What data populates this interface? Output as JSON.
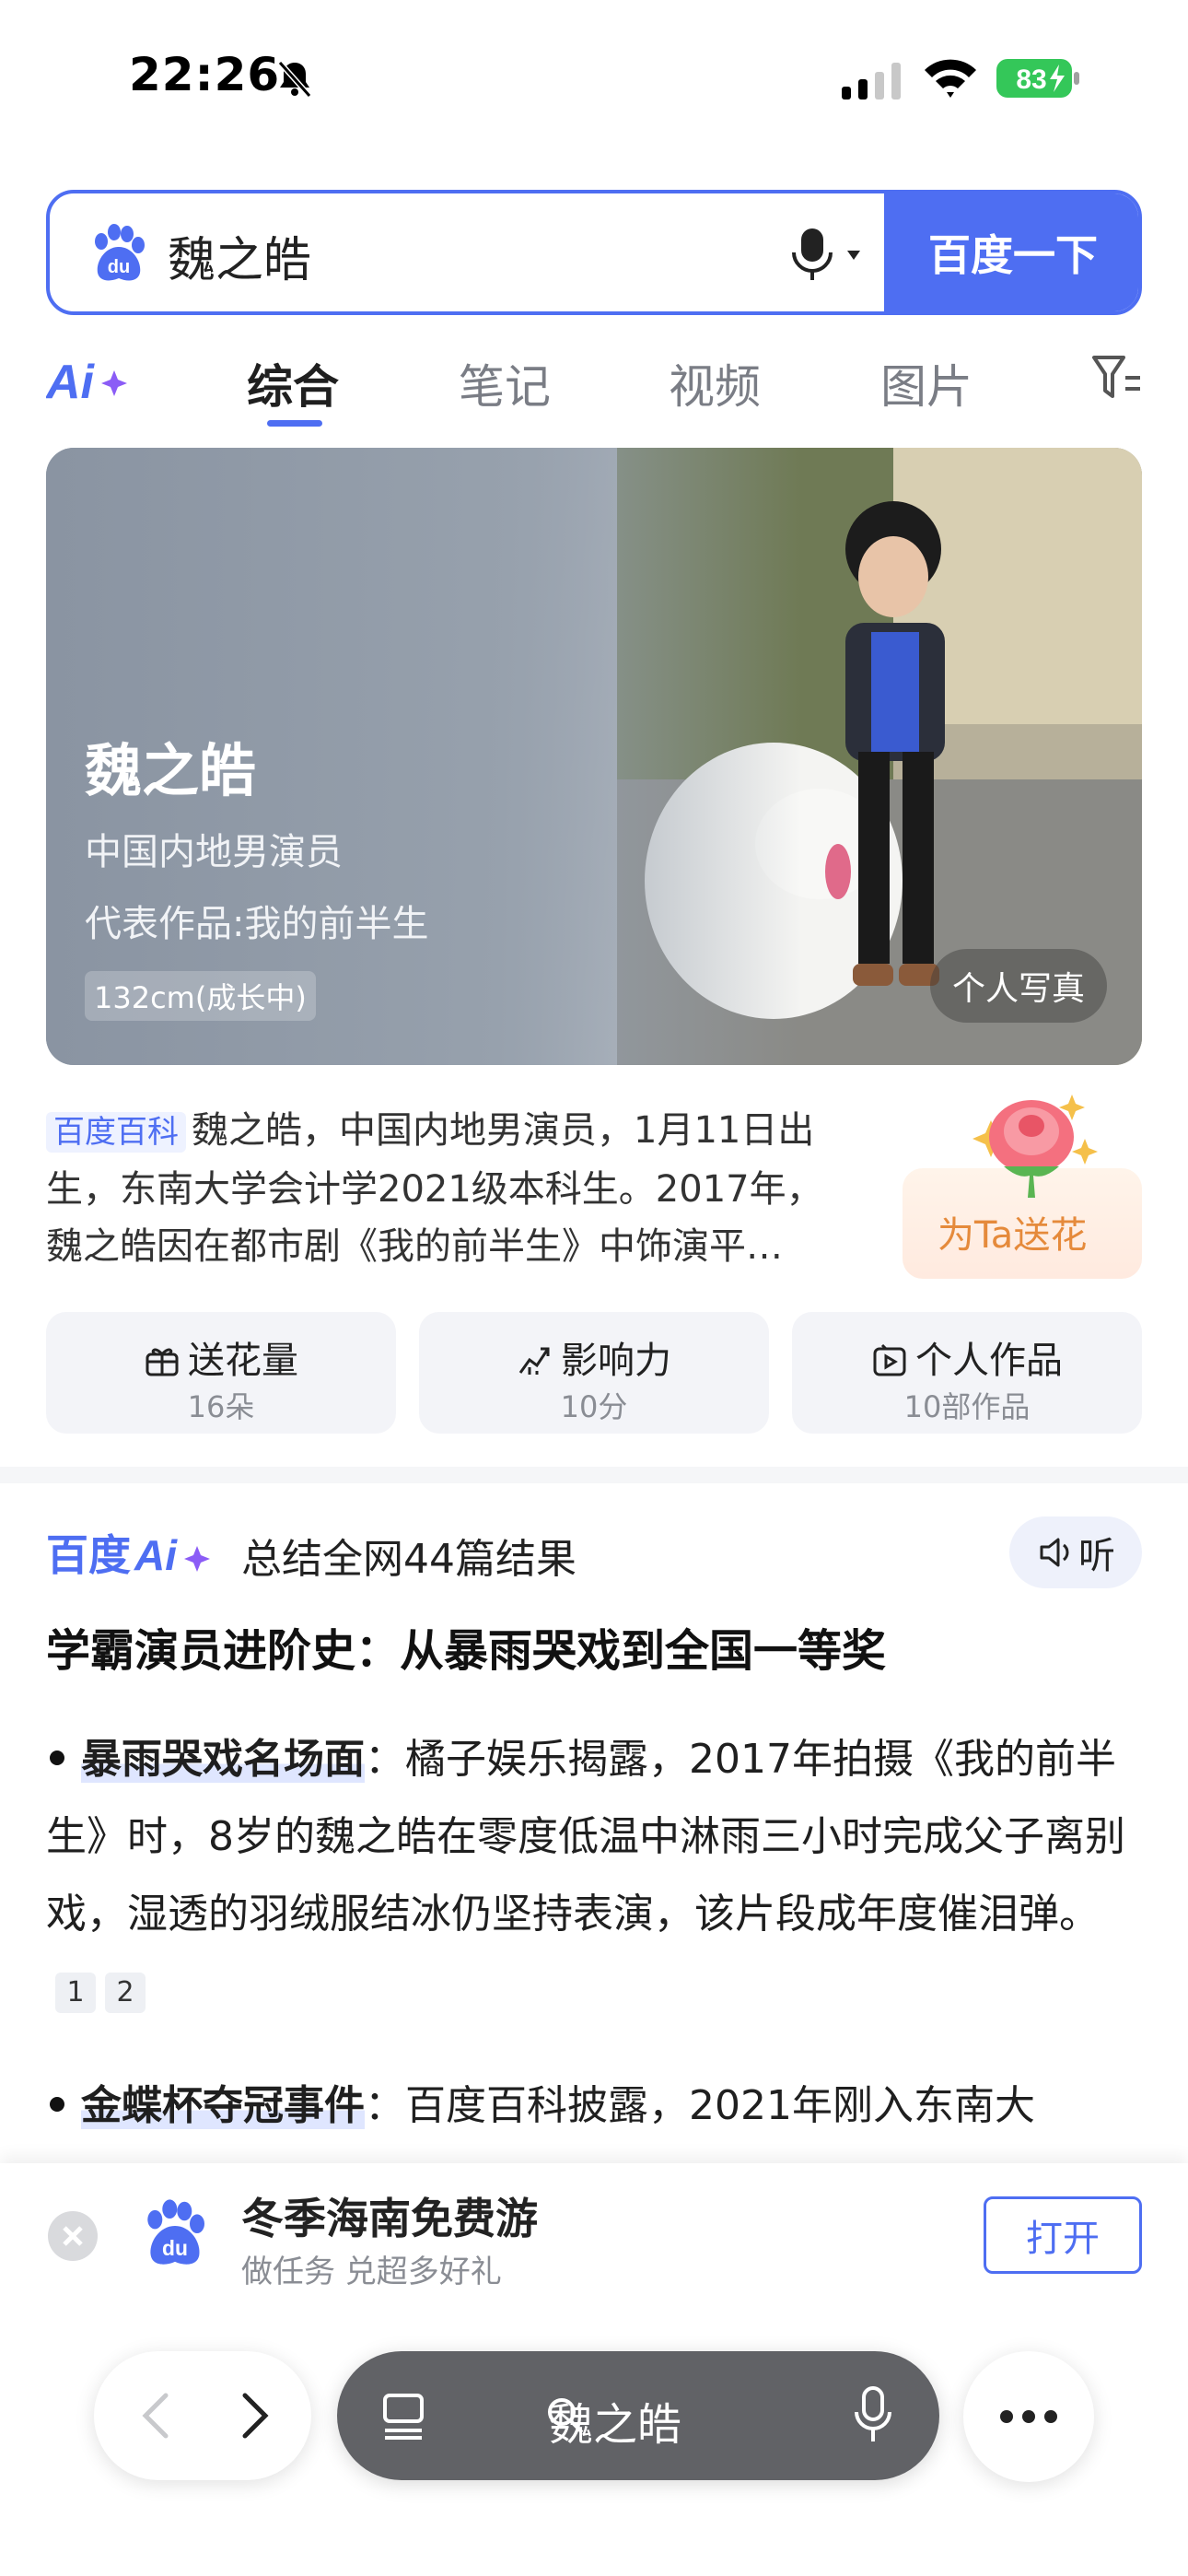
{
  "status_bar": {
    "time": "22:26",
    "battery": "83"
  },
  "search": {
    "query": "魏之皓",
    "button_label": "百度一下"
  },
  "tabs": [
    {
      "label": "综合",
      "active": true
    },
    {
      "label": "笔记"
    },
    {
      "label": "视频"
    },
    {
      "label": "图片"
    }
  ],
  "hero": {
    "name": "魏之皓",
    "subtitle": "中国内地男演员",
    "works": "代表作品:我的前半生",
    "tag": "132cm(成长中)",
    "photo_button": "个人写真"
  },
  "summary": {
    "badge": "百度百科",
    "text": "魏之皓，中国内地男演员，1月11日出生，东南大学会计学2021级本科生。2017年，魏之皓因在都市剧《我的前半生》中饰演平…"
  },
  "flower": {
    "label": "为Ta送花"
  },
  "stats": [
    {
      "title": "送花量",
      "value": "16朵",
      "icon": "gift-icon"
    },
    {
      "title": "影响力",
      "value": "10分",
      "icon": "trend-icon"
    },
    {
      "title": "个人作品",
      "value": "10部作品",
      "icon": "video-icon"
    }
  ],
  "ai_summary": {
    "count_text": "总结全网44篇结果",
    "listen_label": "听",
    "heading": "学霸演员进阶史：从暴雨哭戏到全国一等奖",
    "bullets": [
      {
        "keyword": "暴雨哭戏名场面",
        "text": "：橘子娱乐揭露，2017年拍摄《我的前半生》时，8岁的魏之皓在零度低温中淋雨三小时完成父子离别戏，湿透的羽绒服结冰仍坚持表演，该片段成年度催泪弹。",
        "refs": [
          "1",
          "2"
        ]
      },
      {
        "keyword": "金蝶杯夺冠事件",
        "text": "：百度百科披露，2021年刚入东南大"
      }
    ]
  },
  "banner": {
    "title": "冬季海南免费游",
    "subtitle": "做任务 兑超多好礼",
    "open_label": "打开"
  },
  "bottom_nav": {
    "query": "魏之皓"
  }
}
